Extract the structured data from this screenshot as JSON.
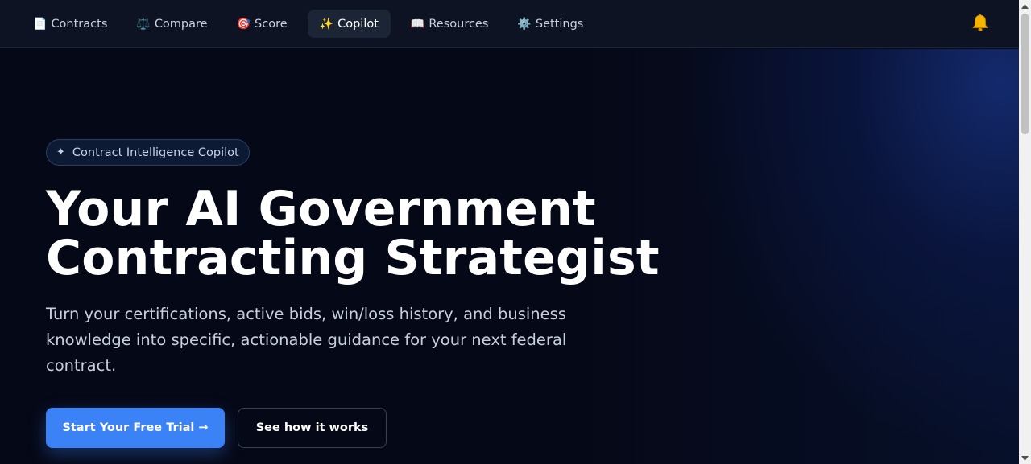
{
  "nav": {
    "items": [
      {
        "icon": "📄",
        "icon_name": "document-icon",
        "label": "Contracts"
      },
      {
        "icon": "⚖️",
        "icon_name": "scales-icon",
        "label": "Compare"
      },
      {
        "icon": "🎯",
        "icon_name": "target-icon",
        "label": "Score"
      },
      {
        "icon": "✨",
        "icon_name": "sparkles-icon",
        "label": "Copilot",
        "active": true
      },
      {
        "icon": "📖",
        "icon_name": "book-icon",
        "label": "Resources"
      },
      {
        "icon": "⚙️",
        "icon_name": "gear-icon",
        "label": "Settings"
      }
    ],
    "notification_icon": "bell-icon"
  },
  "hero": {
    "badge_icon": "✦",
    "badge_label": "Contract Intelligence Copilot",
    "headline_line1": "Your AI Government",
    "headline_line2": "Contracting Strategist",
    "subtitle": "Turn your certifications, active bids, win/loss history, and business knowledge into specific, actionable guidance for your next federal contract.",
    "primary_cta": "Start Your Free Trial →",
    "secondary_cta": "See how it works"
  },
  "colors": {
    "background": "#050816",
    "nav_background": "#0d1322",
    "accent": "#3b82f6",
    "bell": "#f5b400"
  }
}
